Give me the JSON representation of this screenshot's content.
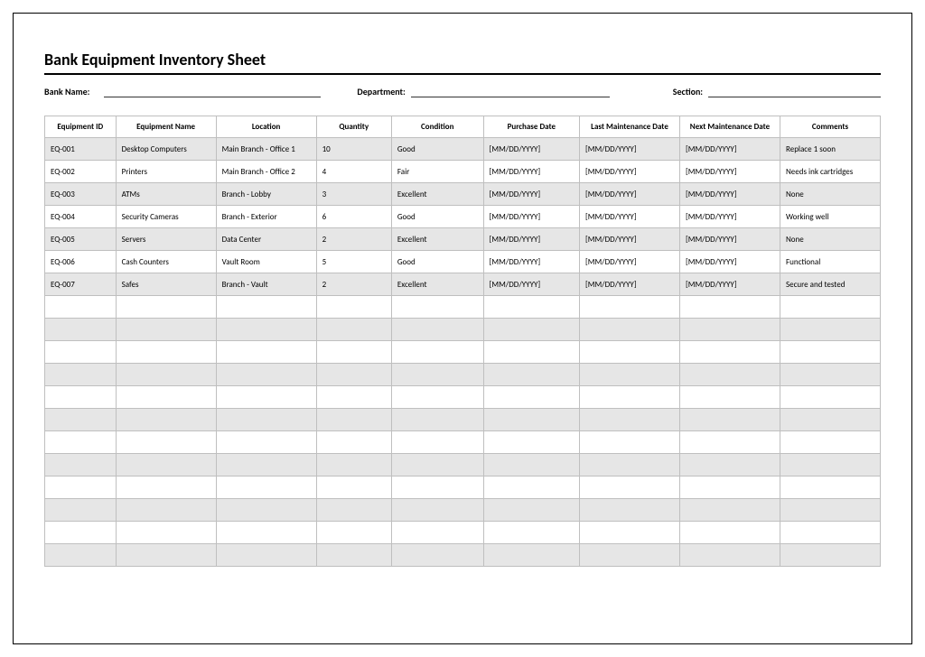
{
  "title": "Bank Equipment Inventory Sheet",
  "meta": {
    "bank_name_label": "Bank Name:",
    "department_label": "Department:",
    "section_label": "Section:"
  },
  "columns": [
    "Equipment ID",
    "Equipment Name",
    "Location",
    "Quantity",
    "Condition",
    "Purchase Date",
    "Last Maintenance Date",
    "Next Maintenance Date",
    "Comments"
  ],
  "rows": [
    {
      "id": "EQ-001",
      "name": "Desktop Computers",
      "location": "Main Branch - Office 1",
      "qty": "10",
      "condition": "Good",
      "purchase": "[MM/DD/YYYY]",
      "last": "[MM/DD/YYYY]",
      "next": "[MM/DD/YYYY]",
      "comments": "Replace 1 soon"
    },
    {
      "id": "EQ-002",
      "name": "Printers",
      "location": "Main Branch - Office 2",
      "qty": "4",
      "condition": "Fair",
      "purchase": "[MM/DD/YYYY]",
      "last": "[MM/DD/YYYY]",
      "next": "[MM/DD/YYYY]",
      "comments": "Needs ink cartridges"
    },
    {
      "id": "EQ-003",
      "name": "ATMs",
      "location": "Branch - Lobby",
      "qty": "3",
      "condition": "Excellent",
      "purchase": "[MM/DD/YYYY]",
      "last": "[MM/DD/YYYY]",
      "next": "[MM/DD/YYYY]",
      "comments": "None"
    },
    {
      "id": "EQ-004",
      "name": "Security Cameras",
      "location": "Branch - Exterior",
      "qty": "6",
      "condition": "Good",
      "purchase": "[MM/DD/YYYY]",
      "last": "[MM/DD/YYYY]",
      "next": "[MM/DD/YYYY]",
      "comments": "Working well"
    },
    {
      "id": "EQ-005",
      "name": "Servers",
      "location": "Data Center",
      "qty": "2",
      "condition": "Excellent",
      "purchase": "[MM/DD/YYYY]",
      "last": "[MM/DD/YYYY]",
      "next": "[MM/DD/YYYY]",
      "comments": "None"
    },
    {
      "id": "EQ-006",
      "name": "Cash Counters",
      "location": "Vault Room",
      "qty": "5",
      "condition": "Good",
      "purchase": "[MM/DD/YYYY]",
      "last": "[MM/DD/YYYY]",
      "next": "[MM/DD/YYYY]",
      "comments": "Functional"
    },
    {
      "id": "EQ-007",
      "name": "Safes",
      "location": "Branch - Vault",
      "qty": "2",
      "condition": "Excellent",
      "purchase": "[MM/DD/YYYY]",
      "last": "[MM/DD/YYYY]",
      "next": "[MM/DD/YYYY]",
      "comments": "Secure and tested"
    }
  ],
  "blank_rows": 12
}
